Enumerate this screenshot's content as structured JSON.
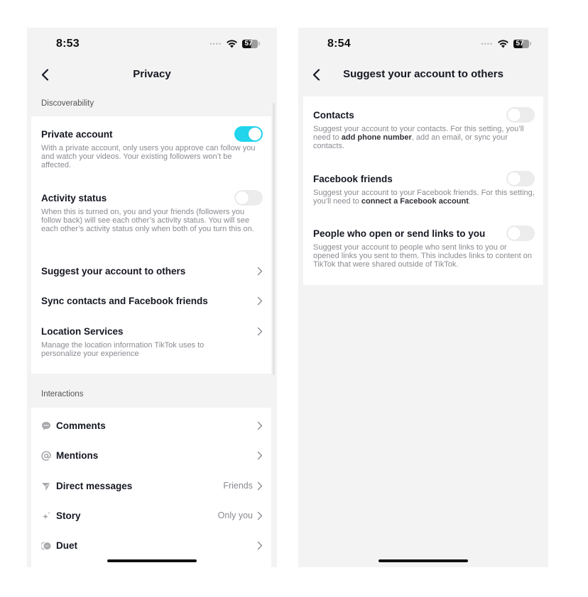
{
  "left_screen": {
    "status": {
      "time": "8:53",
      "battery": "57"
    },
    "header": {
      "title": "Privacy",
      "back_label": "Back"
    },
    "discoverability": {
      "section_label": "Discoverability",
      "private_account": {
        "title": "Private account",
        "description": "With a private account, only users you approve can follow you and watch your videos. Your existing followers won’t be affected.",
        "enabled": true
      },
      "activity_status": {
        "title": "Activity status",
        "description": "When this is turned on, you and your friends (followers you follow back) will see each other’s activity status. You will see each other’s activity status only when both of you turn this on.",
        "enabled": false
      },
      "suggest": {
        "title": "Suggest your account to others"
      },
      "sync": {
        "title": "Sync contacts and Facebook friends"
      },
      "location": {
        "title": "Location Services",
        "description": "Manage the location information TikTok uses to personalize your experience"
      }
    },
    "interactions": {
      "section_label": "Interactions",
      "items": [
        {
          "label": "Comments",
          "value": "",
          "icon": "comment-icon"
        },
        {
          "label": "Mentions",
          "value": "",
          "icon": "at-icon"
        },
        {
          "label": "Direct messages",
          "value": "Friends",
          "icon": "direct-message-icon"
        },
        {
          "label": "Story",
          "value": "Only you",
          "icon": "sparkle-icon"
        },
        {
          "label": "Duet",
          "value": "",
          "icon": "duet-icon"
        }
      ]
    }
  },
  "right_screen": {
    "status": {
      "time": "8:54",
      "battery": "57"
    },
    "header": {
      "title": "Suggest your account to others",
      "back_label": "Back"
    },
    "items": [
      {
        "title": "Contacts",
        "desc_before": "Suggest your account to your contacts. For this setting, you’ll need to ",
        "desc_link": "add phone number",
        "desc_after": ", add an email, or sync your contacts.",
        "enabled": false
      },
      {
        "title": "Facebook friends",
        "desc_before": "Suggest your account to your Facebook friends. For this setting, you’ll need to ",
        "desc_link": "connect a Facebook account",
        "desc_after": ".",
        "enabled": false
      },
      {
        "title": "People who open or send links to you",
        "desc_before": "Suggest your account to people who sent links to you or opened links you sent to them. This includes links to content on TikTok that were shared outside of TikTok.",
        "desc_link": "",
        "desc_after": "",
        "enabled": false
      }
    ]
  },
  "colors": {
    "accent": "#20d5ec",
    "background": "#f3f3f3",
    "card": "#ffffff",
    "text_primary": "#161823",
    "text_secondary": "#8a8b91"
  }
}
